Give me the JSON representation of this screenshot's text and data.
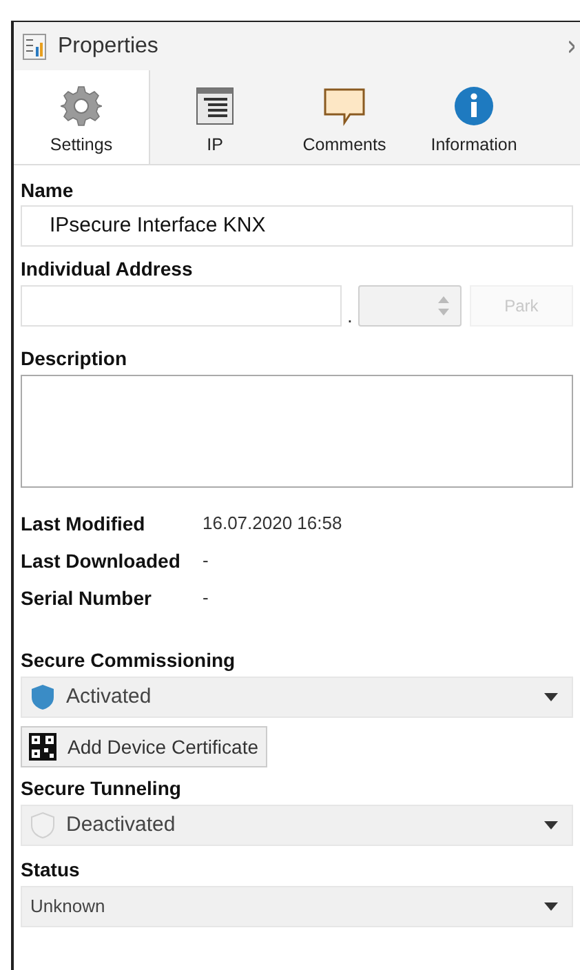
{
  "window": {
    "title": "Properties"
  },
  "tabs": [
    {
      "label": "Settings",
      "kind": "gear",
      "selected": true
    },
    {
      "label": "IP",
      "kind": "list",
      "selected": false
    },
    {
      "label": "Comments",
      "kind": "comment",
      "selected": false
    },
    {
      "label": "Information",
      "kind": "info",
      "selected": false
    }
  ],
  "name": {
    "label": "Name",
    "value": "IPsecure Interface KNX"
  },
  "individual_address": {
    "label": "Individual Address",
    "separator": ".",
    "spinner_disabled": true,
    "park_button": {
      "label": "Park",
      "disabled": true
    }
  },
  "description": {
    "label": "Description"
  },
  "info_rows": [
    {
      "label": "Last Modified",
      "value": "16.07.2020 16:58"
    },
    {
      "label": "Last Downloaded",
      "value": "-"
    },
    {
      "label": "Serial Number",
      "value": "-"
    }
  ],
  "secure_commissioning": {
    "label": "Secure Commissioning",
    "value": "Activated",
    "kind": "shield"
  },
  "add_certificate_button": {
    "label": "Add Device Certificate"
  },
  "secure_tunneling": {
    "label": "Secure Tunneling",
    "value": "Deactivated",
    "kind": "shield-outline"
  },
  "status": {
    "label": "Status",
    "value": "Unknown",
    "kind": "plain"
  }
}
